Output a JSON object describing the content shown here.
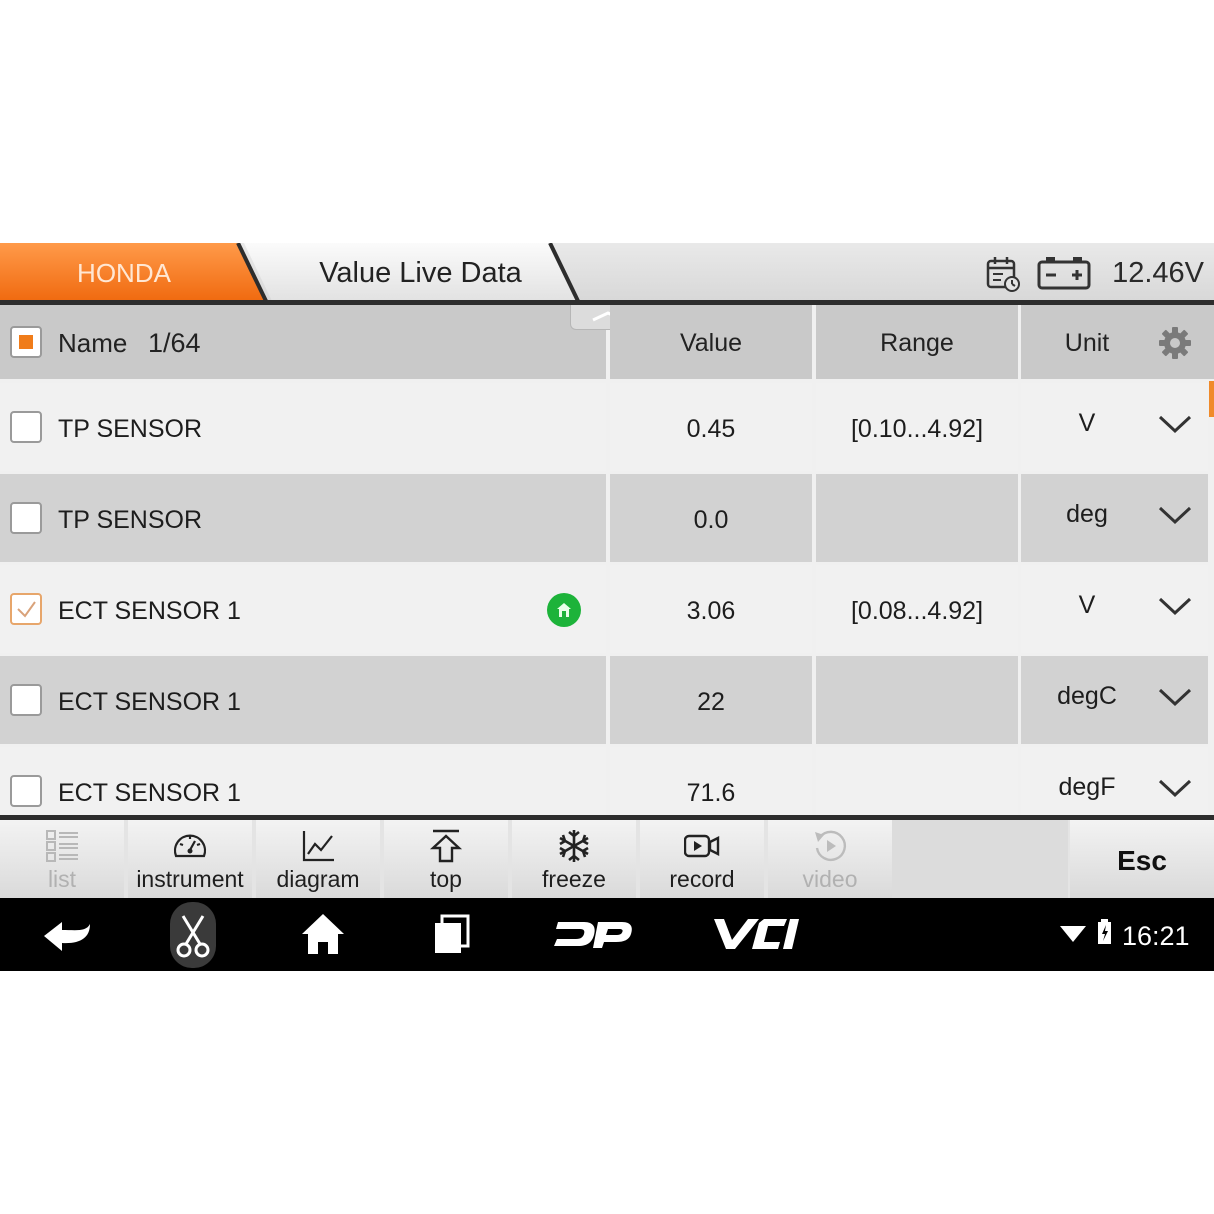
{
  "header": {
    "brand": "HONDA",
    "title": "Value Live Data",
    "voltage": "12.46V",
    "icons": [
      "calendar-icon",
      "battery-icon"
    ]
  },
  "table": {
    "columns": {
      "name": "Name",
      "count": "1/64",
      "value": "Value",
      "range": "Range",
      "unit": "Unit"
    },
    "rows": [
      {
        "name": "TP SENSOR",
        "value": "0.45",
        "range": "[0.10...4.92]",
        "unit": "V",
        "checked": false
      },
      {
        "name": "TP SENSOR",
        "value": "0.0",
        "range": "",
        "unit": "deg",
        "checked": false
      },
      {
        "name": "ECT SENSOR 1",
        "value": "3.06",
        "range": "[0.08...4.92]",
        "unit": "V",
        "checked": true
      },
      {
        "name": "ECT SENSOR 1",
        "value": "22",
        "range": "",
        "unit": "degC",
        "checked": false
      },
      {
        "name": "ECT SENSOR 1",
        "value": "71.6",
        "range": "",
        "unit": "degF",
        "checked": false
      }
    ]
  },
  "toolbar": {
    "list": "list",
    "instrument": "instrument",
    "diagram": "diagram",
    "top": "top",
    "freeze": "freeze",
    "record": "record",
    "video": "video",
    "esc": "Esc"
  },
  "navbar": {
    "clock": "16:21",
    "icons": [
      "back-icon",
      "scissors-icon",
      "home-icon",
      "recent-apps-icon",
      "dp-logo",
      "vci-logo",
      "wifi-icon",
      "battery-status-icon"
    ]
  },
  "colors": {
    "accent": "#f07c1a",
    "header_bg": "#dedede",
    "row_light": "#f1f1f1",
    "row_dark": "#d2d2d2",
    "navbar": "#000000",
    "status_green": "#1db33a"
  }
}
